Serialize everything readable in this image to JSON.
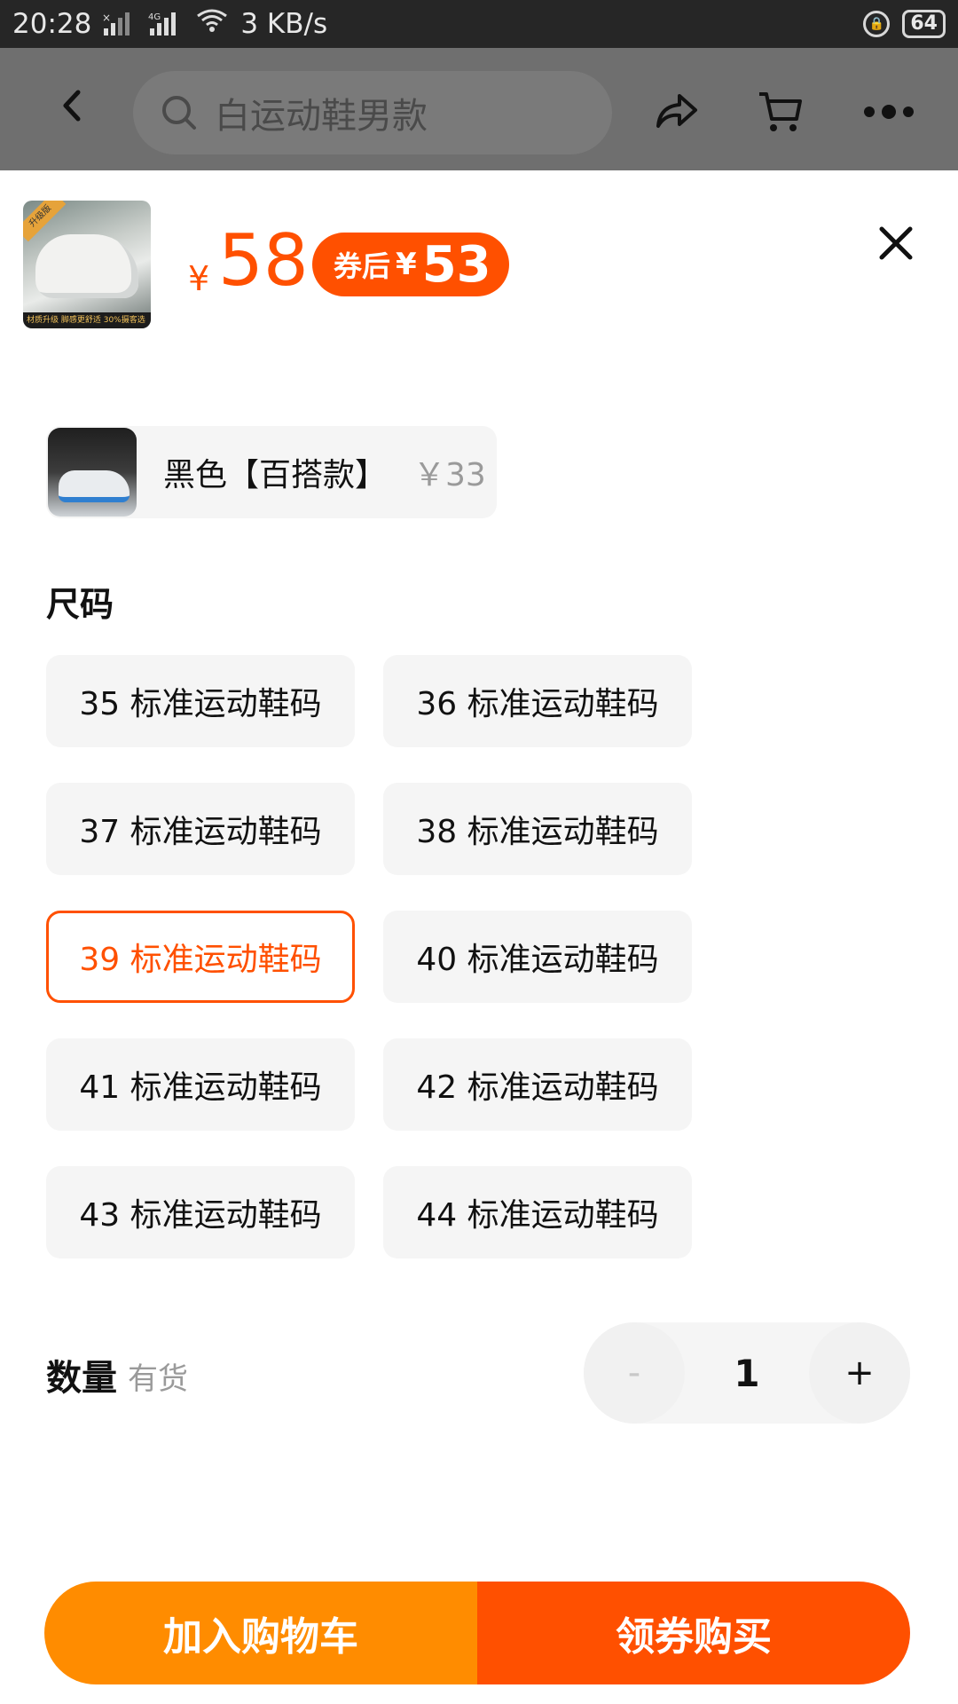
{
  "status_bar": {
    "time": "20:28",
    "network_type": "4G",
    "speed": "3 KB/s",
    "battery": "64"
  },
  "nav": {
    "search_placeholder": "白运动鞋男款"
  },
  "product": {
    "thumb_tag": "升级版",
    "thumb_strip": "材质升级 脚感更舒适 30%摄客选",
    "price_symbol": "¥",
    "price": "58",
    "coupon_label": "券后",
    "coupon_symbol": "¥",
    "coupon_price": "53"
  },
  "color_option": {
    "name": "黑色【百搭款】",
    "price": "￥33"
  },
  "size_section": {
    "title": "尺码",
    "options": [
      "35 标准运动鞋码",
      "36 标准运动鞋码",
      "37 标准运动鞋码",
      "38 标准运动鞋码",
      "39 标准运动鞋码",
      "40 标准运动鞋码",
      "41 标准运动鞋码",
      "42 标准运动鞋码",
      "43 标准运动鞋码",
      "44 标准运动鞋码"
    ],
    "selected": "39 标准运动鞋码"
  },
  "quantity": {
    "label": "数量",
    "stock": "有货",
    "minus": "-",
    "value": "1",
    "plus": "+"
  },
  "actions": {
    "add_to_cart": "加入购物车",
    "buy_with_coupon": "领券购买"
  },
  "colors": {
    "accent": "#ff5000",
    "cart_orange": "#ff8c00"
  }
}
